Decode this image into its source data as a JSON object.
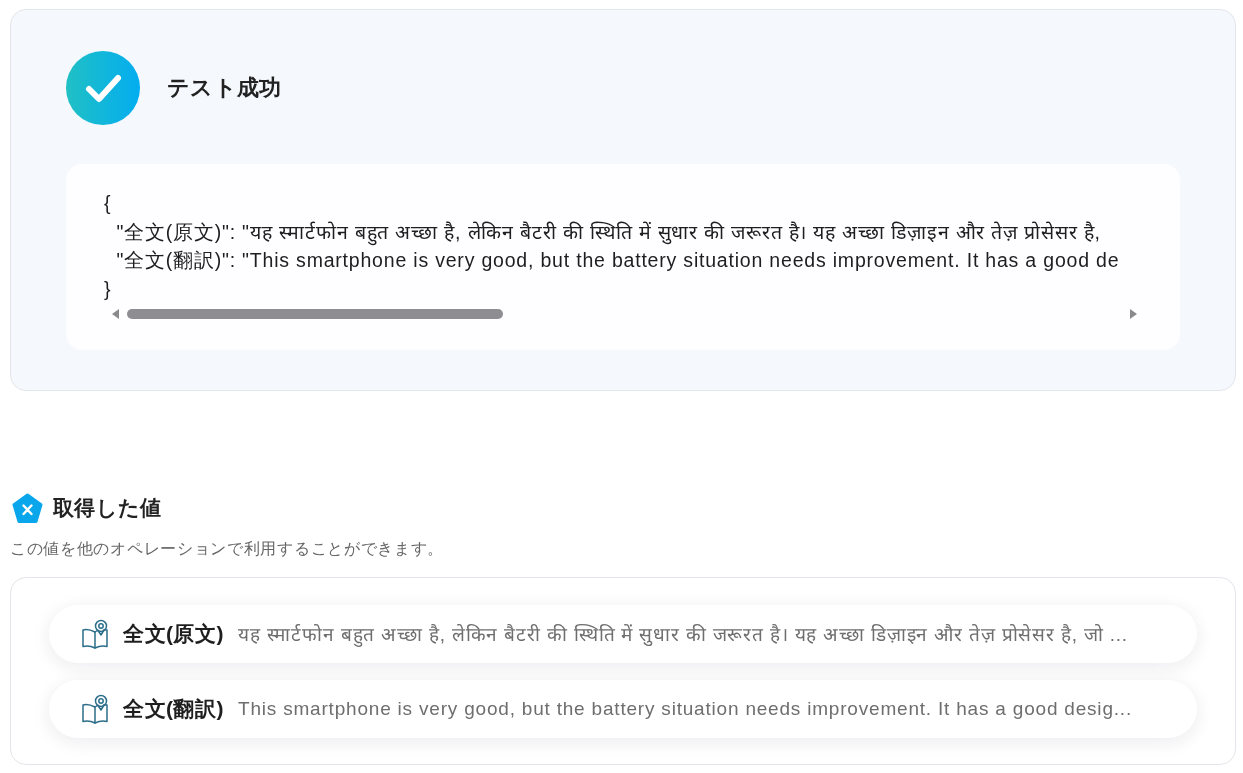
{
  "test_result": {
    "title": "テスト成功",
    "code_lines": [
      "{",
      "  \"全文(原文)\": \"यह स्मार्टफोन बहुत अच्छा है, लेकिन बैटरी की स्थिति में सुधार की जरूरत है। यह अच्छा डिज़ाइन और तेज़ प्रोसेसर है,",
      "  \"全文(翻訳)\": \"This smartphone is very good, but the battery situation needs improvement. It has a good de",
      "}"
    ]
  },
  "obtained_values": {
    "title": "取得した値",
    "description": "この値を他のオペレーションで利用することができます。",
    "items": [
      {
        "label": "全文(原文)",
        "value": "यह स्मार्टफोन बहुत अच्छा है, लेकिन बैटरी की स्थिति में सुधार की जरूरत है। यह अच्छा डिज़ाइन और तेज़ प्रोसेसर है, जो ..."
      },
      {
        "label": "全文(翻訳)",
        "value": "This smartphone is very good, but the battery situation needs improvement. It has a good desig..."
      }
    ]
  }
}
